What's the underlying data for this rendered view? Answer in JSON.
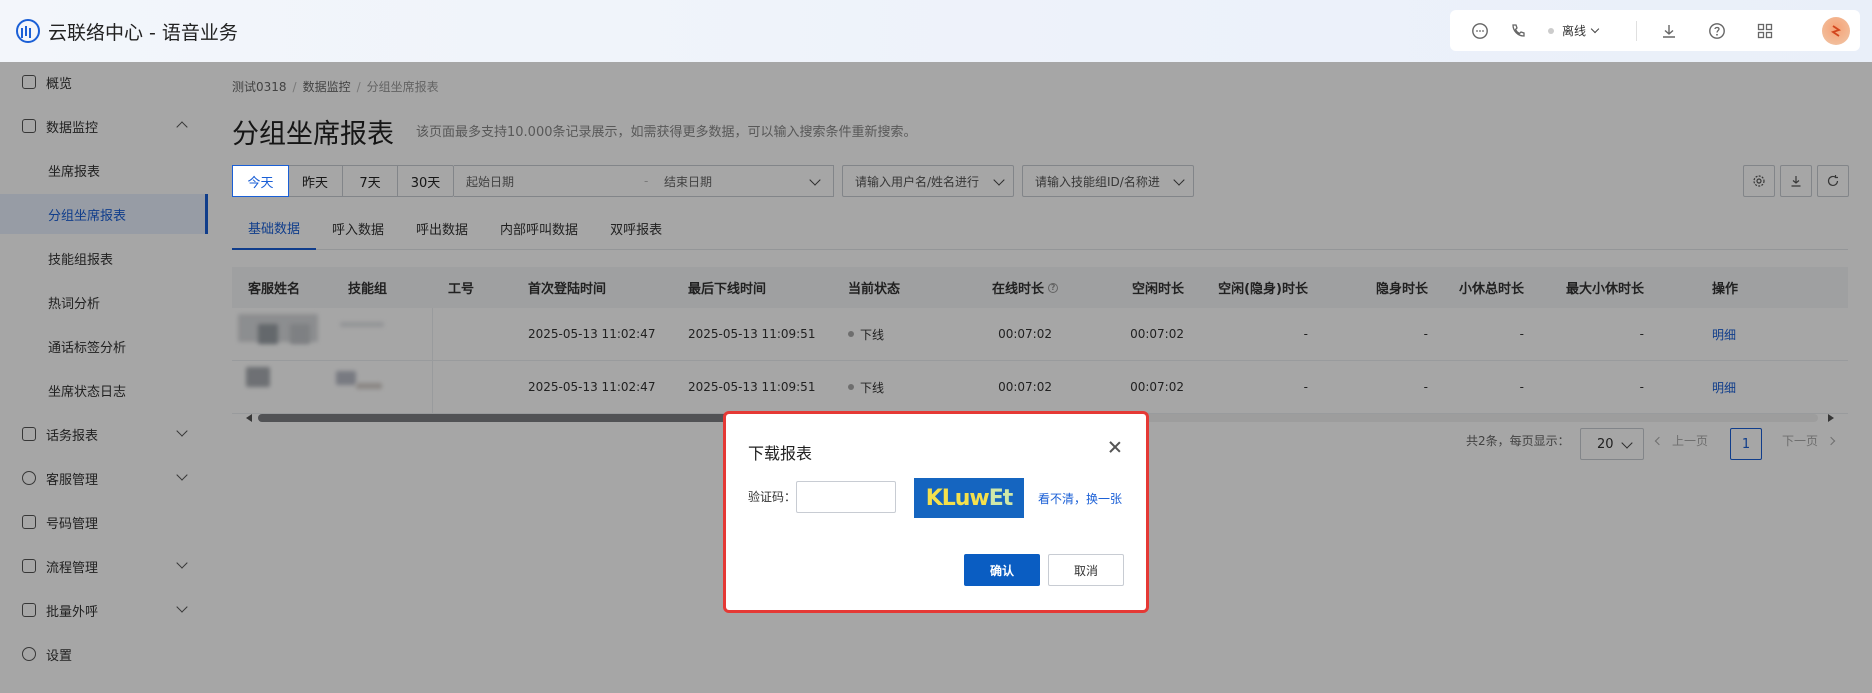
{
  "app": {
    "title": "云联络中心 - 语音业务"
  },
  "header": {
    "status_label": "离线"
  },
  "sidebar": {
    "items": [
      {
        "label": "概览"
      },
      {
        "label": "数据监控"
      },
      {
        "label": "话务报表"
      },
      {
        "label": "客服管理"
      },
      {
        "label": "号码管理"
      },
      {
        "label": "流程管理"
      },
      {
        "label": "批量外呼"
      },
      {
        "label": "设置"
      }
    ],
    "sub_items": [
      {
        "label": "坐席报表"
      },
      {
        "label": "分组坐席报表"
      },
      {
        "label": "技能组报表"
      },
      {
        "label": "热词分析"
      },
      {
        "label": "通话标签分析"
      },
      {
        "label": "坐席状态日志"
      }
    ]
  },
  "breadcrumb": {
    "a": "测试0318",
    "b": "数据监控",
    "c": "分组坐席报表",
    "sep": "/"
  },
  "page": {
    "title": "分组坐席报表",
    "hint": "该页面最多支持10.000条记录展示，如需获得更多数据，可以输入搜索条件重新搜索。"
  },
  "filters": {
    "periods": [
      "今天",
      "昨天",
      "7天",
      "30天"
    ],
    "start_placeholder": "起始日期",
    "range_sep": "-",
    "end_placeholder": "结束日期",
    "user_placeholder": "请输入用户名/姓名进行",
    "skill_placeholder": "请输入技能组ID/名称进"
  },
  "tabs": [
    "基础数据",
    "呼入数据",
    "呼出数据",
    "内部呼叫数据",
    "双呼报表"
  ],
  "table": {
    "columns": [
      "客服姓名",
      "技能组",
      "工号",
      "首次登陆时间",
      "最后下线时间",
      "当前状态",
      "在线时长",
      "空闲时长",
      "空闲(隐身)时长",
      "隐身时长",
      "小休总时长",
      "最大小休时长",
      "操作"
    ],
    "help_glyph": "?",
    "rows": [
      {
        "first_login": "2025-05-13 11:02:47",
        "last_logout": "2025-05-13 11:09:51",
        "status": "下线",
        "online": "00:07:02",
        "idle": "00:07:02",
        "idle_hidden": "-",
        "hidden": "-",
        "break_total": "-",
        "break_max": "-",
        "action": "明细"
      },
      {
        "first_login": "2025-05-13 11:02:47",
        "last_logout": "2025-05-13 11:09:51",
        "status": "下线",
        "online": "00:07:02",
        "idle": "00:07:02",
        "idle_hidden": "-",
        "hidden": "-",
        "break_total": "-",
        "break_max": "-",
        "action": "明细"
      }
    ]
  },
  "pager": {
    "summary": "共2条，每页显示：",
    "page_size": "20",
    "prev": "上一页",
    "current": "1",
    "next": "下一页"
  },
  "dialog": {
    "title": "下载报表",
    "captcha_label": "验证码：",
    "captcha_value": "",
    "captcha_text_a": "KLuw",
    "captcha_text_b": "Et",
    "refresh_label": "看不清，换一张",
    "ok_label": "确认",
    "cancel_label": "取消"
  }
}
